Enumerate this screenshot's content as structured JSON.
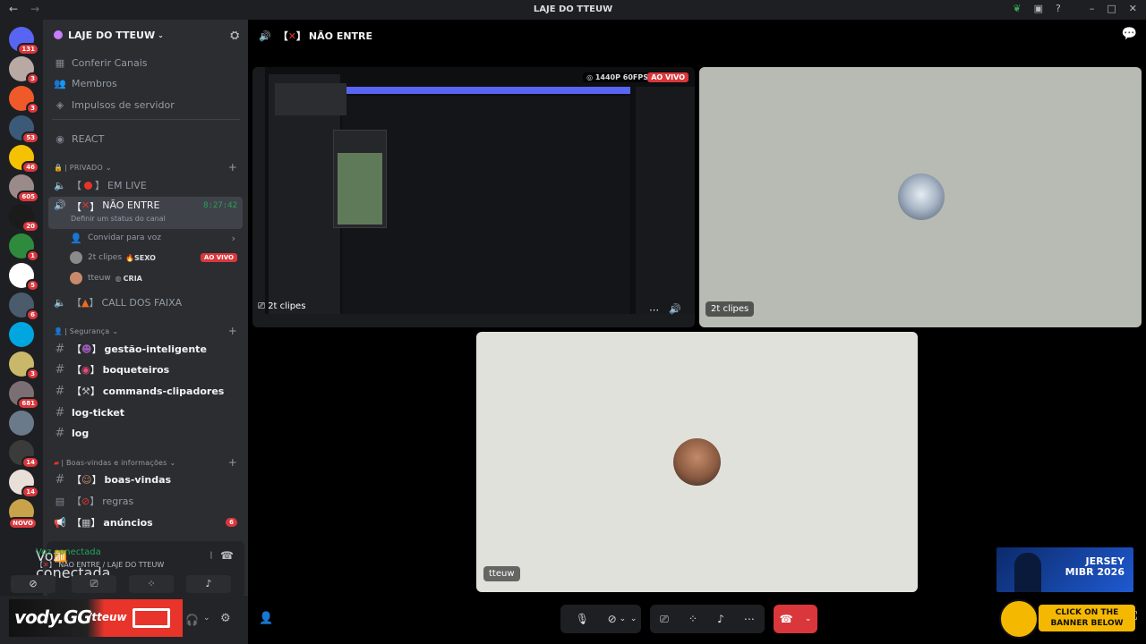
{
  "app": {
    "window_title": "LAJE DO TTEUW"
  },
  "servers": [
    {
      "badge": "131",
      "color": "#5865f2"
    },
    {
      "badge": "3",
      "color": "#b8a9a4"
    },
    {
      "badge": "3",
      "color": "#f05a28"
    },
    {
      "badge": "53",
      "color": "#3a5a78"
    },
    {
      "badge": "46",
      "color": "#f4c200"
    },
    {
      "badge": "605",
      "color": "#9a8a8a"
    },
    {
      "badge": "20",
      "color": "#1b1b1b"
    },
    {
      "badge": "1",
      "color": "#2e8b3d"
    },
    {
      "badge": "5",
      "color": "#ffffff"
    },
    {
      "badge": "6",
      "color": "#4a5b6b"
    },
    {
      "badge": "",
      "color": "#00a6e0"
    },
    {
      "badge": "3",
      "color": "#c9b86a"
    },
    {
      "badge": "681",
      "color": "#7b6f73"
    },
    {
      "badge": "",
      "color": "#6a7a8a"
    },
    {
      "badge": "14",
      "color": "#3b3b3b"
    },
    {
      "badge": "14",
      "color": "#e8e0d8"
    },
    {
      "badge": "NOVO",
      "color": "#c9a34a"
    }
  ],
  "sidebar": {
    "guild_name": "LAJE DO TTEUW",
    "nav": [
      {
        "label": "Conferir Canais",
        "icon": "grid-icon"
      },
      {
        "label": "Membros",
        "icon": "members-icon"
      },
      {
        "label": "Impulsos de servidor",
        "icon": "boost-icon"
      }
    ],
    "react_channel": "REACT",
    "categories": {
      "privado": "| PRIVADO",
      "seguranca": "| Segurança",
      "boas_vindas": "| Boas-vindas e informações"
    },
    "voice_channels": {
      "em_live": "EM LIVE",
      "nao_entre": "NÃO ENTRE",
      "nao_entre_timer": "8:27:42",
      "nao_entre_status": "Definir um status do canal",
      "convidar": "Convidar para voz",
      "call_faixa": "CALL DOS FAIXA"
    },
    "voice_users": [
      {
        "name": "2t clipes",
        "role": "SEXO",
        "live": "AO VIVO"
      },
      {
        "name": "tteuw",
        "role": "CRIA",
        "live": ""
      }
    ],
    "text_channels_security": [
      {
        "label": "gestão-inteligente"
      },
      {
        "label": "boqueteiros"
      },
      {
        "label": "commands-clipadores"
      },
      {
        "label": "log-ticket"
      },
      {
        "label": "log"
      }
    ],
    "text_channels_welcome": [
      {
        "label": "boas-vindas",
        "badge": ""
      },
      {
        "label": "regras",
        "badge": ""
      },
      {
        "label": "anúncios",
        "badge": "6"
      }
    ]
  },
  "voice_panel": {
    "status": "Voz conectada",
    "location": "NÃO ENTRE / LAJE DO TTEUW"
  },
  "banner": {
    "brand": "vody.GG",
    "handle": "/tteuw"
  },
  "main": {
    "channel_title": "NÃO ENTRE",
    "stream": {
      "quality": "1440P 60FPS",
      "live": "AO VIVO",
      "name": "2t clipes"
    },
    "tiles": {
      "top_right_name": "2t clipes",
      "bottom_name": "tteuw"
    },
    "ad": {
      "line1": "JERSEY",
      "line2": "MIBR 2026",
      "cta": "CLICK ON THE BANNER BELOW"
    }
  }
}
